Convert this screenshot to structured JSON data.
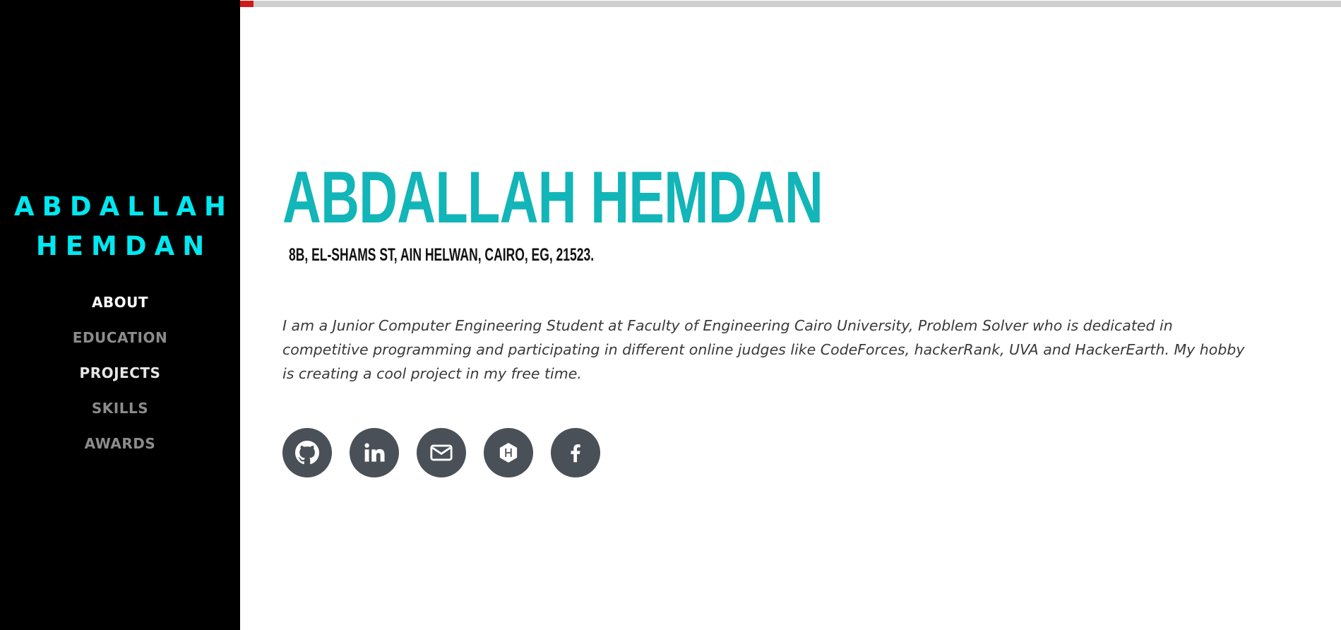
{
  "sidebar": {
    "brand_line1": "ABDALLAH",
    "brand_line2": "HEMDAN",
    "brand_color": "#00e8f0",
    "nav": [
      {
        "label": "ABOUT",
        "state": "active"
      },
      {
        "label": "EDUCATION",
        "state": "dim"
      },
      {
        "label": "PROJECTS",
        "state": "bright"
      },
      {
        "label": "SKILLS",
        "state": "dim"
      },
      {
        "label": "AWARDS",
        "state": "dim"
      }
    ]
  },
  "scroll_progress": {
    "fill_color": "#d11a1a",
    "track_color": "#cfcfcf"
  },
  "about": {
    "name": "ABDALLAH HEMDAN",
    "name_color": "#12b5b8",
    "address": "8B, EL-SHAMS ST, AIN HELWAN, CAIRO, EG, 21523.",
    "bio": "I am a Junior Computer Engineering Student at Faculty of Engineering Cairo University, Problem Solver who is dedicated in competitive programming and participating in different online judges like CodeForces, hackerRank, UVA and HackerEarth. My hobby is creating a cool project in my free time."
  },
  "social_links": [
    {
      "icon": "github-icon"
    },
    {
      "icon": "linkedin-icon"
    },
    {
      "icon": "envelope-icon"
    },
    {
      "icon": "hackerrank-icon"
    },
    {
      "icon": "facebook-icon"
    }
  ],
  "social_bg_color": "#495057"
}
